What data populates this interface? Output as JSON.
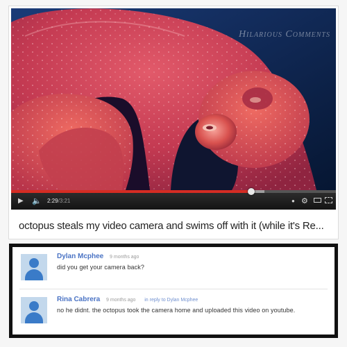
{
  "video": {
    "watermark": "Hilarious Comments",
    "title": "octopus steals my video camera and swims off with it (while it's Re...",
    "player": {
      "time_current": "2:29",
      "time_separator": "/",
      "time_total": "3:21",
      "progress_played": 0.74,
      "progress_loaded": 0.78
    },
    "icons": {
      "play": "play-icon",
      "volume": "volume-icon",
      "settings": "gear-icon",
      "fullscreen": "fullscreen-icon"
    }
  },
  "comments": [
    {
      "author": "Dylan Mcphee",
      "timestamp": "9 months ago",
      "text": "did you get your camera back?"
    },
    {
      "author": "Rina Cabrera",
      "timestamp": "9 months ago",
      "reply_to": "in reply to Dylan Mcphee",
      "text": "no he didnt. the octopus took the camera home and uploaded this video on youtube."
    }
  ],
  "colors": {
    "progress_played": "#d52c23",
    "author_link": "#4a73c4",
    "avatar_blue": "#3a7bc8",
    "comments_frame": "#111111"
  }
}
